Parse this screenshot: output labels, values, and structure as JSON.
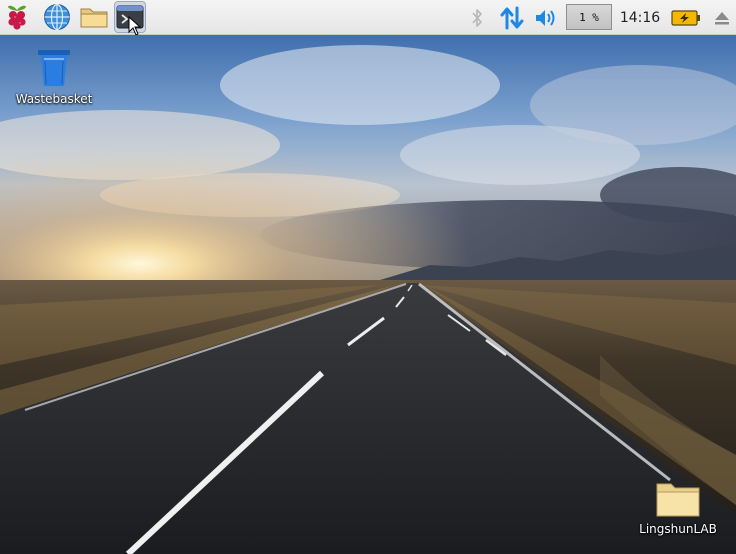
{
  "taskbar": {
    "launchers": [
      {
        "name": "raspberry-menu",
        "icon": "raspberry-icon"
      },
      {
        "name": "web-browser",
        "icon": "globe-icon"
      },
      {
        "name": "file-manager",
        "icon": "folder-icon"
      },
      {
        "name": "terminal",
        "icon": "terminal-icon"
      }
    ],
    "tray": {
      "bluetooth_icon": "bluetooth-icon",
      "network_icon": "network-arrows-icon",
      "volume_icon": "speaker-icon",
      "cpu_usage": "1 %",
      "clock": "14:16",
      "battery_icon": "battery-charging-icon",
      "eject_icon": "eject-icon"
    }
  },
  "desktop": {
    "wallpaper": "road-sunset",
    "icons": [
      {
        "label": "Wastebasket",
        "icon": "trash-icon"
      },
      {
        "label": "LingshunLAB",
        "icon": "folder-icon"
      }
    ]
  },
  "colors": {
    "accent_blue": "#1e88e5",
    "panel_bg": "#eeeeee",
    "battery_yellow": "#f5b800"
  }
}
